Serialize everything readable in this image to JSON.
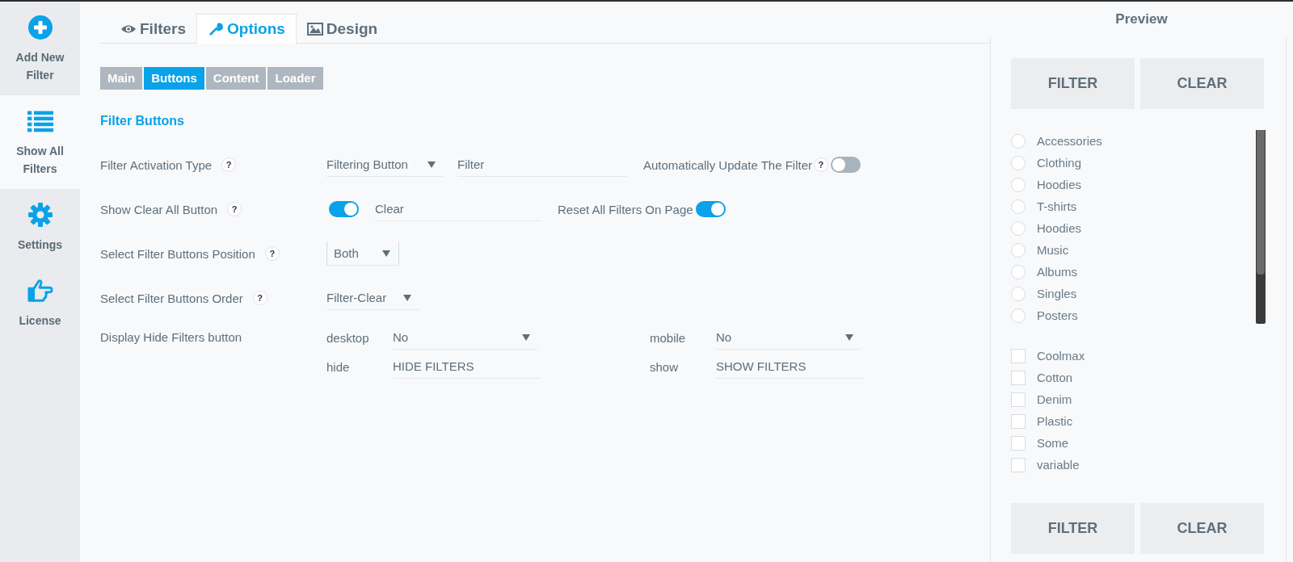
{
  "sidebar": {
    "items": [
      {
        "label": "Add New Filter",
        "selected": false
      },
      {
        "label": "Show All Filters",
        "selected": true
      },
      {
        "label": "Settings",
        "selected": false
      },
      {
        "label": "License",
        "selected": false
      }
    ]
  },
  "tabs": [
    {
      "label": "Filters",
      "selected": false
    },
    {
      "label": "Options",
      "selected": true
    },
    {
      "label": "Design",
      "selected": false
    }
  ],
  "subtabs": [
    {
      "label": "Main",
      "selected": false
    },
    {
      "label": "Buttons",
      "selected": true
    },
    {
      "label": "Content",
      "selected": false
    },
    {
      "label": "Loader",
      "selected": false
    }
  ],
  "section_title": "Filter Buttons",
  "activation": {
    "label": "Filter Activation Type",
    "help": "?",
    "select": "Filtering Button",
    "text": "Filter",
    "auto_update": {
      "label": "Automatically Update The Filter",
      "help": "?",
      "on": false
    }
  },
  "clear_all": {
    "label": "Show Clear All Button",
    "help": "?",
    "on": true,
    "text": "Clear",
    "reset": {
      "label": "Reset All Filters On Page",
      "on": true
    }
  },
  "position": {
    "label": "Select Filter Buttons Position",
    "help": "?",
    "select": "Both"
  },
  "order": {
    "label": "Select Filter Buttons Order",
    "help": "?",
    "select": "Filter-Clear"
  },
  "hide_filters": {
    "label": "Display Hide Filters button",
    "fields": [
      {
        "label": "desktop",
        "kind": "select",
        "value": "No"
      },
      {
        "label": "mobile",
        "kind": "select",
        "value": "No"
      },
      {
        "label": "hide",
        "kind": "text",
        "value": "HIDE FILTERS"
      },
      {
        "label": "show",
        "kind": "text",
        "value": "SHOW FILTERS"
      }
    ]
  },
  "preview": {
    "title": "Preview",
    "top_buttons": [
      "FILTER",
      "CLEAR"
    ],
    "radios": [
      {
        "label": "Accessories",
        "selected": false
      },
      {
        "label": "Clothing",
        "selected": false
      },
      {
        "label": "Hoodies",
        "selected": false
      },
      {
        "label": "T-shirts",
        "selected": false
      },
      {
        "label": "Hoodies",
        "selected": false
      },
      {
        "label": "Music",
        "selected": false
      },
      {
        "label": "Albums",
        "selected": false
      },
      {
        "label": "Singles",
        "selected": false
      },
      {
        "label": "Posters",
        "selected": false
      }
    ],
    "checkboxes": [
      {
        "label": "Coolmax",
        "checked": false
      },
      {
        "label": "Cotton",
        "checked": false
      },
      {
        "label": "Denim",
        "checked": false
      },
      {
        "label": "Plastic",
        "checked": false
      },
      {
        "label": "Some",
        "checked": false
      },
      {
        "label": "variable",
        "checked": false
      }
    ],
    "bottom_buttons": [
      "FILTER",
      "CLEAR"
    ]
  }
}
